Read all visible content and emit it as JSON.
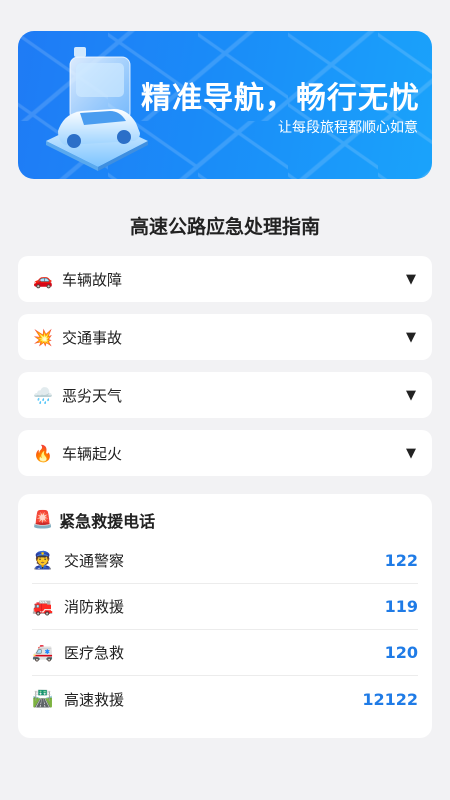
{
  "banner": {
    "title": "精准导航，畅行无忧",
    "subtitle": "让每段旅程都顺心如意"
  },
  "guide": {
    "title": "高速公路应急处理指南",
    "items": [
      {
        "icon": "car-icon",
        "emoji": "🚗",
        "label": "车辆故障"
      },
      {
        "icon": "collision-icon",
        "emoji": "💥",
        "label": "交通事故"
      },
      {
        "icon": "cloud-rain-icon",
        "emoji": "🌧️",
        "label": "恶劣天气"
      },
      {
        "icon": "fire-icon",
        "emoji": "🔥",
        "label": "车辆起火"
      }
    ],
    "expand_glyph": "▼"
  },
  "emergency": {
    "icon": "siren-icon",
    "emoji": "🚨",
    "title": "紧急救援电话",
    "contacts": [
      {
        "icon": "police-officer-icon",
        "emoji": "👮",
        "name": "交通警察",
        "number": "122"
      },
      {
        "icon": "fire-engine-icon",
        "emoji": "🚒",
        "name": "消防救援",
        "number": "119"
      },
      {
        "icon": "ambulance-icon",
        "emoji": "🚑",
        "name": "医疗急救",
        "number": "120"
      },
      {
        "icon": "highway-icon",
        "emoji": "🛣️",
        "name": "高速救援",
        "number": "12122"
      }
    ]
  },
  "colors": {
    "accent": "#1f7be6",
    "banner_start": "#1f7bf5",
    "banner_end": "#1aa3fb",
    "background": "#f2f2f4"
  }
}
